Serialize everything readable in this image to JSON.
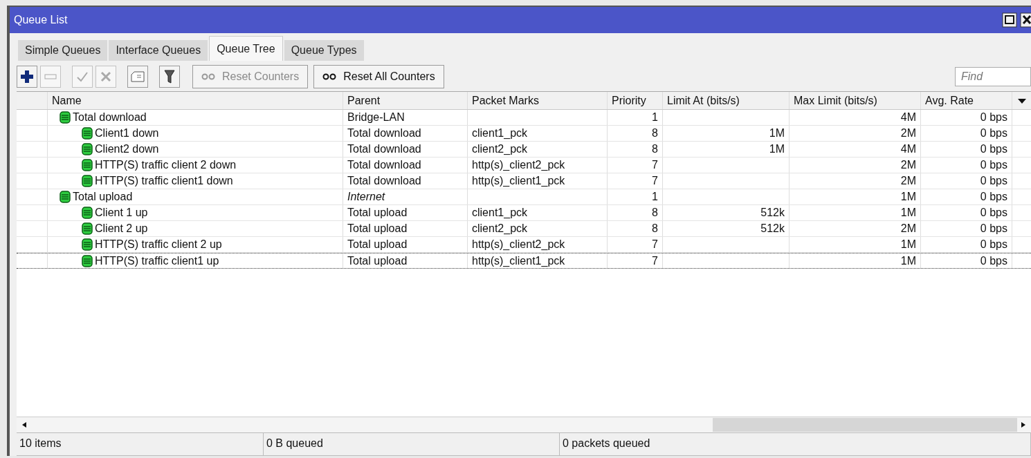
{
  "window": {
    "title": "Queue List"
  },
  "tabs": [
    {
      "label": "Simple Queues",
      "selected": false
    },
    {
      "label": "Interface Queues",
      "selected": false
    },
    {
      "label": "Queue Tree",
      "selected": true
    },
    {
      "label": "Queue Types",
      "selected": false
    }
  ],
  "toolbar": [
    {
      "kind": "add",
      "disabled": false
    },
    {
      "kind": "remove",
      "disabled": true
    },
    {
      "kind": "enable",
      "disabled": true
    },
    {
      "kind": "disable",
      "disabled": true
    },
    {
      "kind": "comment",
      "disabled": false
    },
    {
      "kind": "filter",
      "disabled": false
    }
  ],
  "counter_buttons": [
    {
      "label": "Reset Counters",
      "disabled": true
    },
    {
      "label": "Reset All Counters",
      "disabled": false
    }
  ],
  "search": {
    "placeholder": "Find"
  },
  "table": {
    "columns": [
      "Name",
      "Parent",
      "Packet Marks",
      "Priority",
      "Limit At (bits/s)",
      "Max Limit (bits/s)",
      "Avg. Rate"
    ],
    "rows": [
      {
        "name": "Total download",
        "parent": "Bridge-LAN",
        "parent_italic": false,
        "priority": "1",
        "max_limit": "4M",
        "avg_rate": "0 bps",
        "focused": false,
        "children": [
          {
            "name": "Client1 down",
            "parent": "Total download",
            "parent_italic": false,
            "packet_marks": "client1_pck",
            "priority": "8",
            "limit_at": "1M",
            "max_limit": "2M",
            "avg_rate": "0 bps",
            "focused": false
          },
          {
            "name": "Client2 down",
            "parent": "Total download",
            "parent_italic": false,
            "packet_marks": "client2_pck",
            "priority": "8",
            "limit_at": "1M",
            "max_limit": "4M",
            "avg_rate": "0 bps",
            "focused": false
          },
          {
            "name": "HTTP(S) traffic client 2 down",
            "parent": "Total download",
            "parent_italic": false,
            "packet_marks": "http(s)_client2_pck",
            "priority": "7",
            "max_limit": "2M",
            "avg_rate": "0 bps",
            "focused": false
          },
          {
            "name": "HTTP(S) traffic client1 down",
            "parent": "Total download",
            "parent_italic": false,
            "packet_marks": "http(s)_client1_pck",
            "priority": "7",
            "max_limit": "2M",
            "avg_rate": "0 bps",
            "focused": false
          }
        ]
      },
      {
        "name": "Total upload",
        "parent": "Internet",
        "parent_italic": true,
        "priority": "1",
        "max_limit": "1M",
        "avg_rate": "0 bps",
        "focused": false,
        "children": [
          {
            "name": "Client 1 up",
            "parent": "Total upload",
            "parent_italic": false,
            "packet_marks": "client1_pck",
            "priority": "8",
            "limit_at": "512k",
            "max_limit": "1M",
            "avg_rate": "0 bps",
            "focused": false
          },
          {
            "name": "Client 2 up",
            "parent": "Total upload",
            "parent_italic": false,
            "packet_marks": "client2_pck",
            "priority": "8",
            "limit_at": "512k",
            "max_limit": "2M",
            "avg_rate": "0 bps",
            "focused": false
          },
          {
            "name": "HTTP(S) traffic client 2 up",
            "parent": "Total upload",
            "parent_italic": false,
            "packet_marks": "http(s)_client2_pck",
            "priority": "7",
            "max_limit": "1M",
            "avg_rate": "0 bps",
            "focused": false
          },
          {
            "name": "HTTP(S) traffic client1 up",
            "parent": "Total upload",
            "parent_italic": false,
            "packet_marks": "http(s)_client1_pck",
            "priority": "7",
            "max_limit": "1M",
            "avg_rate": "0 bps",
            "focused": true
          }
        ]
      }
    ]
  },
  "status_bar": [
    "10 items",
    "0 B queued",
    "0 packets queued"
  ]
}
